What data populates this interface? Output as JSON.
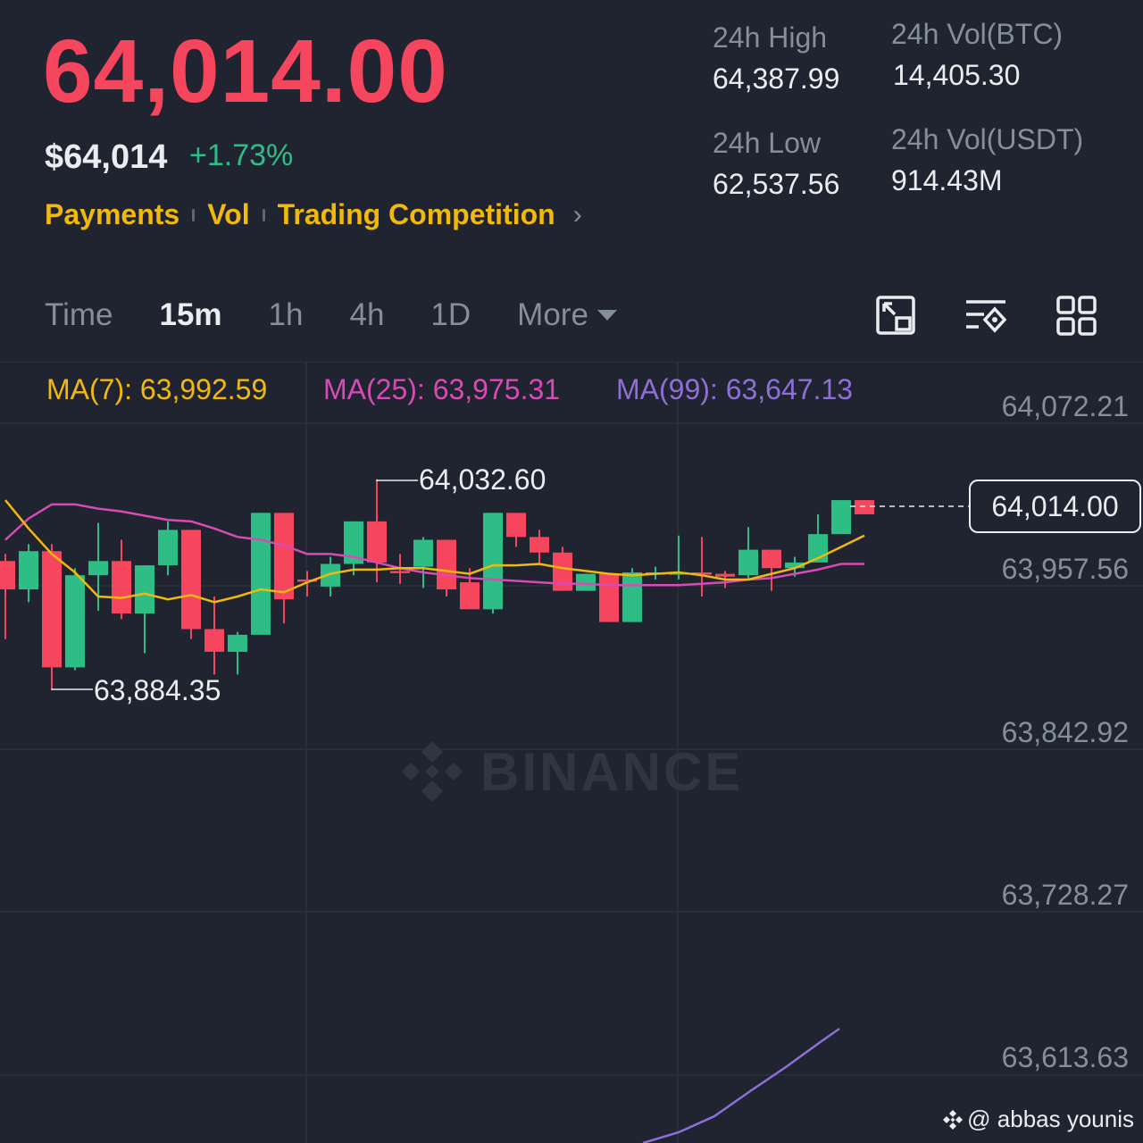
{
  "ticker": {
    "last_price": "64,014.00",
    "usd_price": "$64,014",
    "change_pct": "+1.73%"
  },
  "links": [
    {
      "label": "Payments"
    },
    {
      "label": "Vol"
    },
    {
      "label": "Trading Competition"
    }
  ],
  "stats": {
    "high_label": "24h High",
    "high_value": "64,387.99",
    "low_label": "24h Low",
    "low_value": "62,537.56",
    "vol_btc_label": "24h Vol(BTC)",
    "vol_btc_value": "14,405.30",
    "vol_usdt_label": "24h Vol(USDT)",
    "vol_usdt_value": "914.43M"
  },
  "tabs": {
    "time": "Time",
    "m15": "15m",
    "h1": "1h",
    "h4": "4h",
    "d1": "1D",
    "more": "More"
  },
  "toolbar_icons": [
    "fullscreen-icon",
    "indicator-settings-icon",
    "grid-layout-icon"
  ],
  "ma": {
    "ma7": "MA(7): 63,992.59",
    "ma25": "MA(25): 63,975.31",
    "ma99": "MA(99): 63,647.13"
  },
  "colors": {
    "up": "#2ebd85",
    "down": "#f6465d",
    "ma7": "#f0b90b",
    "ma25": "#d84ab4",
    "ma99": "#8e6fd6",
    "brand": "#f0b90b"
  },
  "chart_data": {
    "type": "candlestick",
    "y_axis_ticks": [
      "64,072.21",
      "63,957.56",
      "63,842.92",
      "63,728.27",
      "63,613.63"
    ],
    "current_price": "64,014.00",
    "high_marker": "64,032.60",
    "low_marker": "63,884.35",
    "candles": [
      {
        "o": 63955,
        "h": 63980,
        "l": 63920,
        "c": 63975,
        "dir": "down"
      },
      {
        "o": 63955,
        "h": 63987,
        "l": 63946,
        "c": 63982,
        "dir": "up"
      },
      {
        "o": 63982,
        "h": 63987,
        "l": 63884,
        "c": 63900,
        "dir": "down"
      },
      {
        "o": 63900,
        "h": 63970,
        "l": 63898,
        "c": 63965,
        "dir": "up"
      },
      {
        "o": 63965,
        "h": 64002,
        "l": 63940,
        "c": 63975,
        "dir": "up"
      },
      {
        "o": 63975,
        "h": 63990,
        "l": 63934,
        "c": 63938,
        "dir": "down"
      },
      {
        "o": 63938,
        "h": 63972,
        "l": 63910,
        "c": 63972,
        "dir": "up"
      },
      {
        "o": 63972,
        "h": 64003,
        "l": 63965,
        "c": 63997,
        "dir": "up"
      },
      {
        "o": 63997,
        "h": 63997,
        "l": 63920,
        "c": 63927,
        "dir": "down"
      },
      {
        "o": 63927,
        "h": 63950,
        "l": 63895,
        "c": 63911,
        "dir": "down"
      },
      {
        "o": 63911,
        "h": 63925,
        "l": 63895,
        "c": 63923,
        "dir": "up"
      },
      {
        "o": 63923,
        "h": 64009,
        "l": 63923,
        "c": 64009,
        "dir": "up"
      },
      {
        "o": 64009,
        "h": 64009,
        "l": 63931,
        "c": 63948,
        "dir": "down"
      },
      {
        "o": 63962,
        "h": 63968,
        "l": 63950,
        "c": 63962,
        "dir": "down"
      },
      {
        "o": 63957,
        "h": 63978,
        "l": 63950,
        "c": 63973,
        "dir": "up"
      },
      {
        "o": 63973,
        "h": 64003,
        "l": 63965,
        "c": 64003,
        "dir": "up"
      },
      {
        "o": 64003,
        "h": 64032.6,
        "l": 63960,
        "c": 63974,
        "dir": "down"
      },
      {
        "o": 63968,
        "h": 63980,
        "l": 63959,
        "c": 63968,
        "dir": "down"
      },
      {
        "o": 63971,
        "h": 63992,
        "l": 63956,
        "c": 63990,
        "dir": "up"
      },
      {
        "o": 63990,
        "h": 63990,
        "l": 63950,
        "c": 63955,
        "dir": "down"
      },
      {
        "o": 63960,
        "h": 63970,
        "l": 63941,
        "c": 63941,
        "dir": "down"
      },
      {
        "o": 63941,
        "h": 64009,
        "l": 63938,
        "c": 64009,
        "dir": "up"
      },
      {
        "o": 64009,
        "h": 64009,
        "l": 63985,
        "c": 63992,
        "dir": "down"
      },
      {
        "o": 63992,
        "h": 63997,
        "l": 63973,
        "c": 63981,
        "dir": "down"
      },
      {
        "o": 63981,
        "h": 63985,
        "l": 63954,
        "c": 63954,
        "dir": "down"
      },
      {
        "o": 63954,
        "h": 63966,
        "l": 63954,
        "c": 63966,
        "dir": "up"
      },
      {
        "o": 63966,
        "h": 63966,
        "l": 63932,
        "c": 63932,
        "dir": "down"
      },
      {
        "o": 63932,
        "h": 63970,
        "l": 63932,
        "c": 63967,
        "dir": "up"
      },
      {
        "o": 63967,
        "h": 63971,
        "l": 63962,
        "c": 63967,
        "dir": "up"
      },
      {
        "o": 63967,
        "h": 63993,
        "l": 63962,
        "c": 63967,
        "dir": "up"
      },
      {
        "o": 63967,
        "h": 63992,
        "l": 63950,
        "c": 63967,
        "dir": "down"
      },
      {
        "o": 63966,
        "h": 63968,
        "l": 63956,
        "c": 63964,
        "dir": "down"
      },
      {
        "o": 63965,
        "h": 63999,
        "l": 63963,
        "c": 63983,
        "dir": "up"
      },
      {
        "o": 63983,
        "h": 63983,
        "l": 63954,
        "c": 63970,
        "dir": "down"
      },
      {
        "o": 63970,
        "h": 63978,
        "l": 63964,
        "c": 63974,
        "dir": "up"
      },
      {
        "o": 63974,
        "h": 64008,
        "l": 63974,
        "c": 63994,
        "dir": "up"
      },
      {
        "o": 63994,
        "h": 64018,
        "l": 63994,
        "c": 64018,
        "dir": "up"
      },
      {
        "o": 64018,
        "h": 64018,
        "l": 64008,
        "c": 64008,
        "dir": "down"
      }
    ],
    "ma7_values": [
      64018,
      63998,
      63980,
      63967,
      63950,
      63949,
      63952,
      63948,
      63951,
      63946,
      63950,
      63955,
      63953,
      63960,
      63966,
      63969,
      63969,
      63970,
      63970,
      63968,
      63966,
      63972,
      63972,
      63973,
      63970,
      63968,
      63966,
      63965,
      63966,
      63967,
      63965,
      63962,
      63962,
      63966,
      63970,
      63977,
      63985,
      63993
    ],
    "ma25_values": [
      63990,
      64005,
      64015,
      64015,
      64012,
      64010,
      64007,
      64004,
      64003,
      63998,
      63992,
      63990,
      63986,
      63980,
      63980,
      63978,
      63974,
      63970,
      63967,
      63965,
      63963,
      63962,
      63961,
      63960,
      63959,
      63959,
      63958,
      63958,
      63958,
      63958,
      63959,
      63960,
      63962,
      63963,
      63966,
      63969,
      63973,
      63973
    ],
    "ma99_tail": [
      63546,
      63555,
      63566,
      63578,
      63590,
      63602,
      63614,
      63623
    ]
  },
  "credit": "@ abbas younis"
}
